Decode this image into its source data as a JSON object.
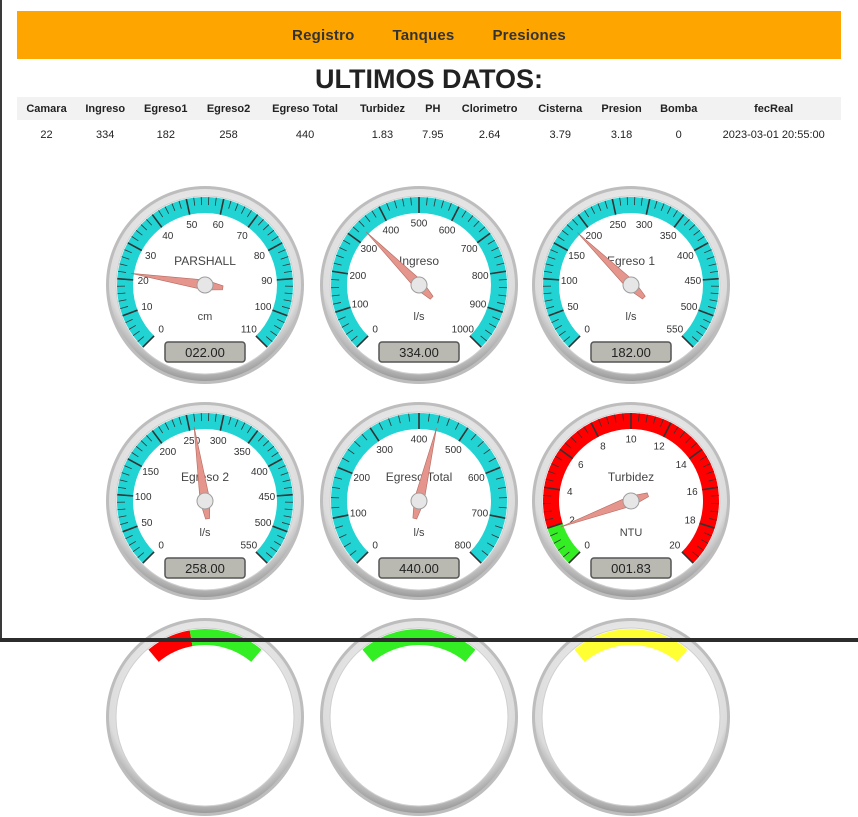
{
  "nav": {
    "items": [
      "Registro",
      "Tanques",
      "Presiones"
    ]
  },
  "title": "ULTIMOS DATOS:",
  "table": {
    "headers": [
      "Camara",
      "Ingreso",
      "Egreso1",
      "Egreso2",
      "Egreso Total",
      "Turbidez",
      "PH",
      "Clorimetro",
      "Cisterna",
      "Presion",
      "Bomba",
      "fecReal"
    ],
    "rows": [
      [
        "22",
        "334",
        "182",
        "258",
        "440",
        "1.83",
        "7.95",
        "2.64",
        "3.79",
        "3.18",
        "0",
        "2023-03-01 20:55:00"
      ]
    ]
  },
  "colors": {
    "navbar": "#FFA500",
    "gauge_band": "#22D3D3",
    "zone_red": "#FF0000",
    "zone_green": "#33EE22",
    "needle": "#E5958C",
    "lcd": "#B9B9B2"
  },
  "gauges": [
    {
      "title": "PARSHALL",
      "units": "cm",
      "min": 0,
      "max": 110,
      "value": 22,
      "display": "022.00",
      "ticks": [
        "0",
        "10",
        "20",
        "30",
        "40",
        "50",
        "60",
        "70",
        "80",
        "90",
        "100",
        "110"
      ],
      "style": "cyan"
    },
    {
      "title": "Ingreso",
      "units": "l/s",
      "min": 0,
      "max": 1000,
      "value": 334,
      "display": "334.00",
      "ticks": [
        "0",
        "100",
        "200",
        "300",
        "400",
        "500",
        "600",
        "700",
        "800",
        "900",
        "1000"
      ],
      "style": "cyan"
    },
    {
      "title": "Egreso 1",
      "units": "l/s",
      "min": 0,
      "max": 550,
      "value": 182,
      "display": "182.00",
      "ticks": [
        "0",
        "50",
        "100",
        "150",
        "200",
        "250",
        "300",
        "350",
        "400",
        "450",
        "500",
        "550"
      ],
      "style": "cyan"
    },
    {
      "title": "Egreso 2",
      "units": "l/s",
      "min": 0,
      "max": 550,
      "value": 258,
      "display": "258.00",
      "ticks": [
        "0",
        "50",
        "100",
        "150",
        "200",
        "250",
        "300",
        "350",
        "400",
        "450",
        "500",
        "550"
      ],
      "style": "cyan"
    },
    {
      "title": "Egreso Total",
      "units": "l/s",
      "min": 0,
      "max": 800,
      "value": 440,
      "display": "440.00",
      "ticks": [
        "0",
        "100",
        "200",
        "300",
        "400",
        "500",
        "600",
        "700",
        "800"
      ],
      "style": "cyan"
    },
    {
      "title": "Turbidez",
      "units": "NTU",
      "min": 0,
      "max": 20,
      "value": 1.83,
      "display": "001.83",
      "ticks": [
        "0",
        "2",
        "4",
        "6",
        "8",
        "10",
        "12",
        "14",
        "16",
        "18",
        "20"
      ],
      "style": "zones",
      "zones": [
        {
          "from": 0,
          "to": 2,
          "color": "zone_green"
        },
        {
          "from": 2,
          "to": 20,
          "color": "zone_red"
        }
      ]
    },
    {
      "title": "",
      "units": "",
      "min": 0,
      "max": 20,
      "value": 0,
      "display": "",
      "ticks": [],
      "style": "partial-red-green"
    },
    {
      "title": "",
      "units": "",
      "min": 0,
      "max": 20,
      "value": 0,
      "display": "",
      "ticks": [],
      "style": "partial-green"
    },
    {
      "title": "",
      "units": "",
      "min": 0,
      "max": 20,
      "value": 0,
      "display": "",
      "ticks": [],
      "style": "partial-yellow"
    }
  ]
}
